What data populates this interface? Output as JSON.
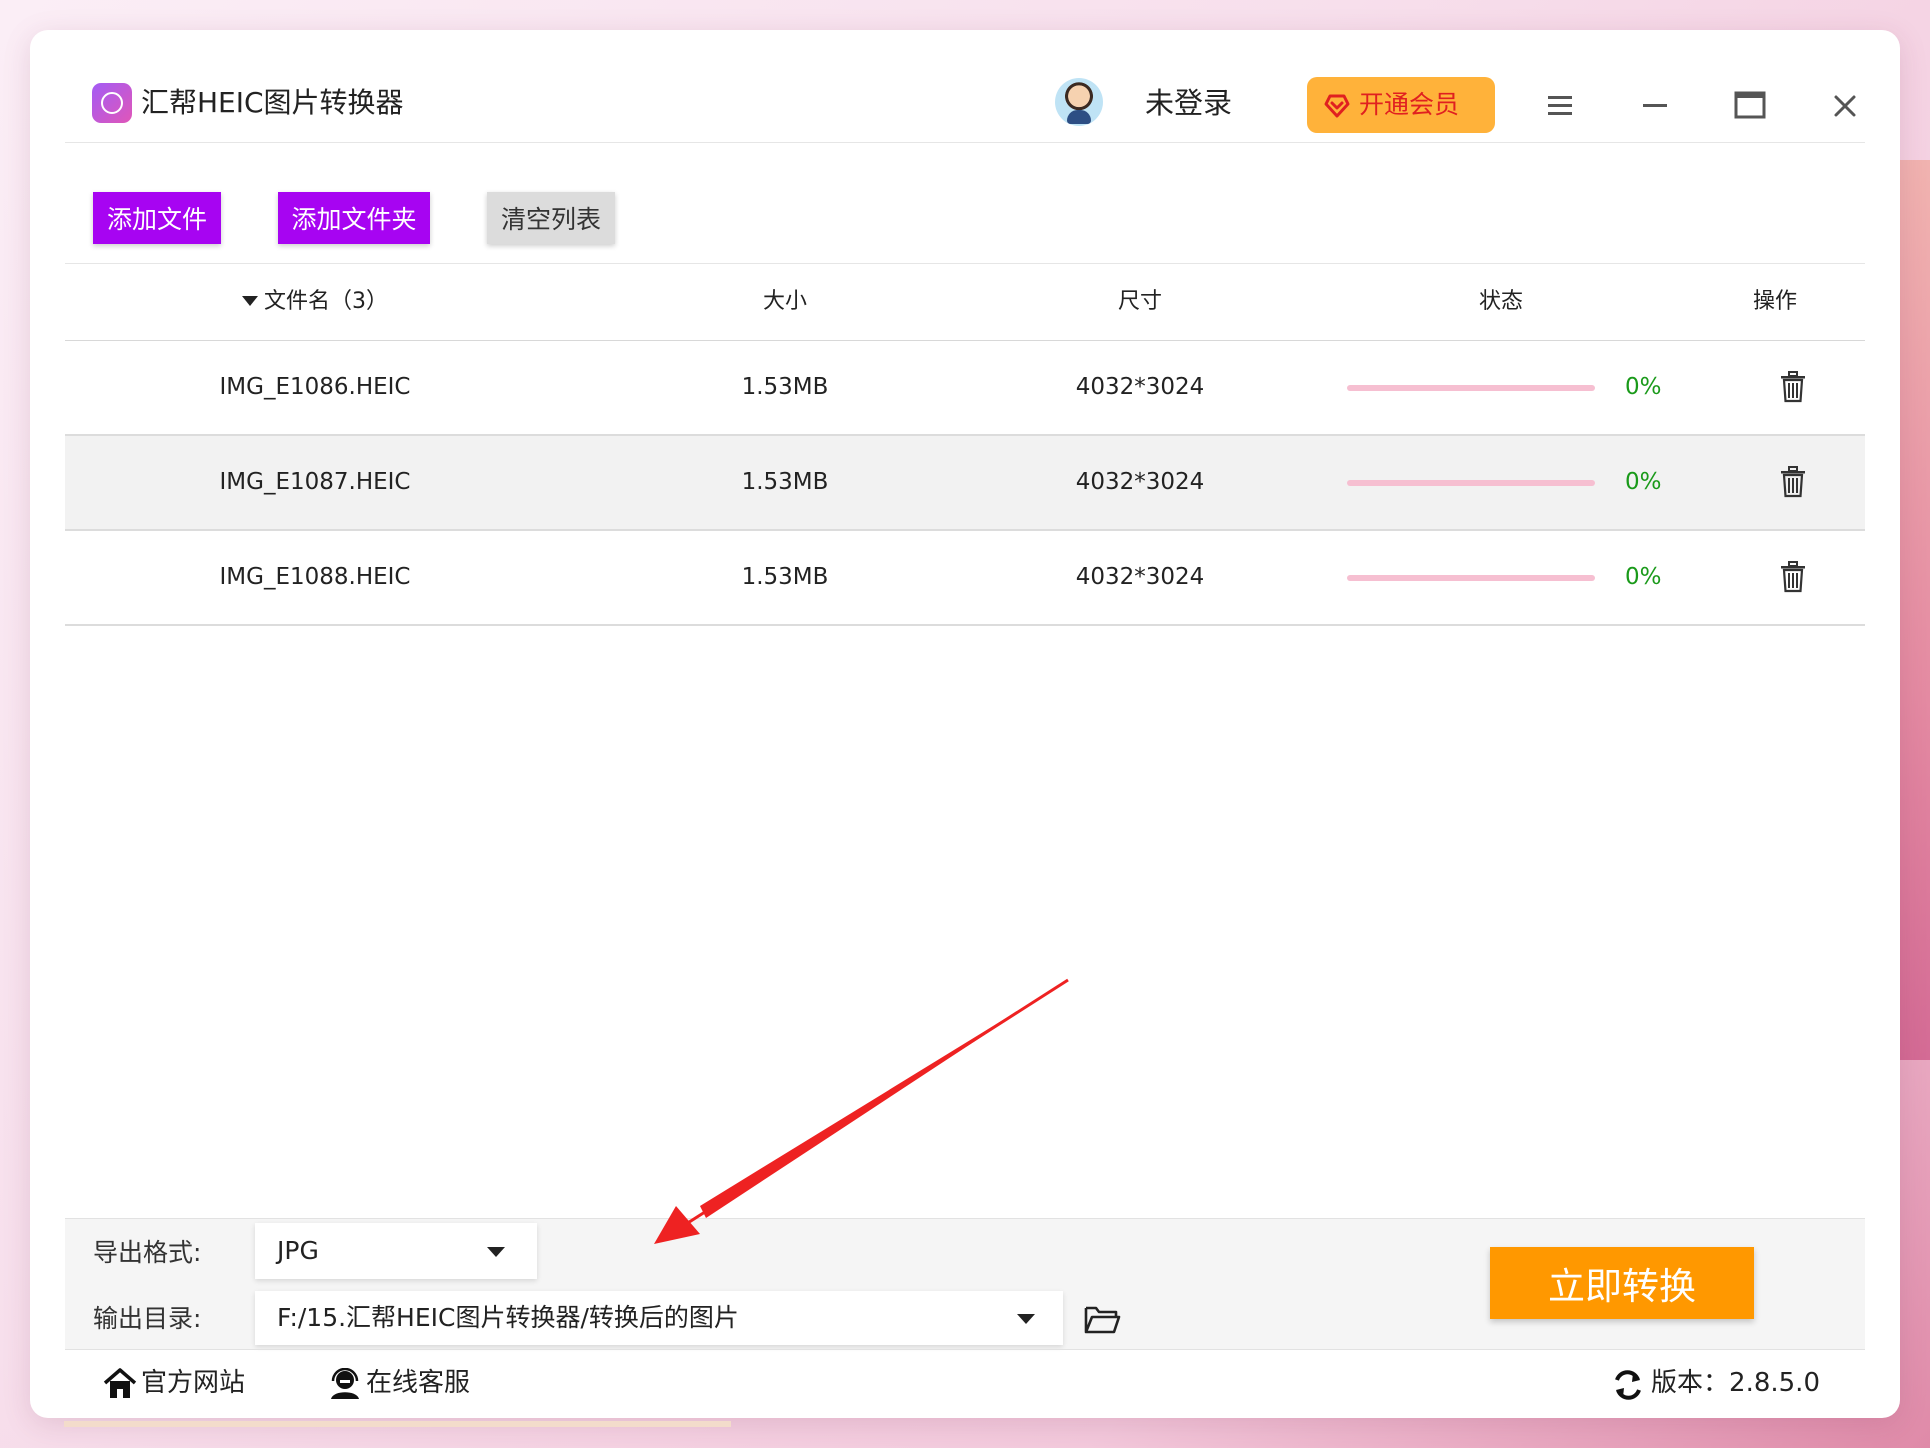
{
  "app": {
    "title": "汇帮HEIC图片转换器",
    "login_status": "未登录",
    "vip_button": "开通会员"
  },
  "toolbar": {
    "add_file": "添加文件",
    "add_folder": "添加文件夹",
    "clear_list": "清空列表"
  },
  "table": {
    "headers": {
      "filename": "文件名（3）",
      "size": "大小",
      "dimensions": "尺寸",
      "status": "状态",
      "action": "操作"
    },
    "rows": [
      {
        "name": "IMG_E1086.HEIC",
        "size": "1.53MB",
        "dimensions": "4032*3024",
        "progress": "0%"
      },
      {
        "name": "IMG_E1087.HEIC",
        "size": "1.53MB",
        "dimensions": "4032*3024",
        "progress": "0%"
      },
      {
        "name": "IMG_E1088.HEIC",
        "size": "1.53MB",
        "dimensions": "4032*3024",
        "progress": "0%"
      }
    ]
  },
  "output": {
    "format_label": "导出格式:",
    "format_value": "JPG",
    "dir_label": "输出目录:",
    "dir_value": "F:/15.汇帮HEIC图片转换器/转换后的图片",
    "convert_button": "立即转换"
  },
  "footer": {
    "website": "官方网站",
    "support": "在线客服",
    "version": "版本：2.8.5.0"
  },
  "colors": {
    "accent_purple": "#a704f2",
    "convert_orange": "#ff9800",
    "vip_yellow": "#ffb23a",
    "vip_text": "#e02020",
    "progress_green": "#1a9a1a",
    "progress_track": "#f6bfd1",
    "annotation_arrow": "#ee2222"
  },
  "icons": {
    "logo": "heic-app-logo-icon",
    "avatar": "user-avatar-icon",
    "vip": "diamond-heart-icon",
    "menu": "hamburger-menu-icon",
    "minimize": "minimize-icon",
    "maximize": "maximize-icon",
    "close": "close-icon",
    "delete": "trash-icon",
    "folder": "folder-open-icon",
    "home": "home-icon",
    "support": "headset-icon",
    "refresh": "refresh-icon"
  }
}
